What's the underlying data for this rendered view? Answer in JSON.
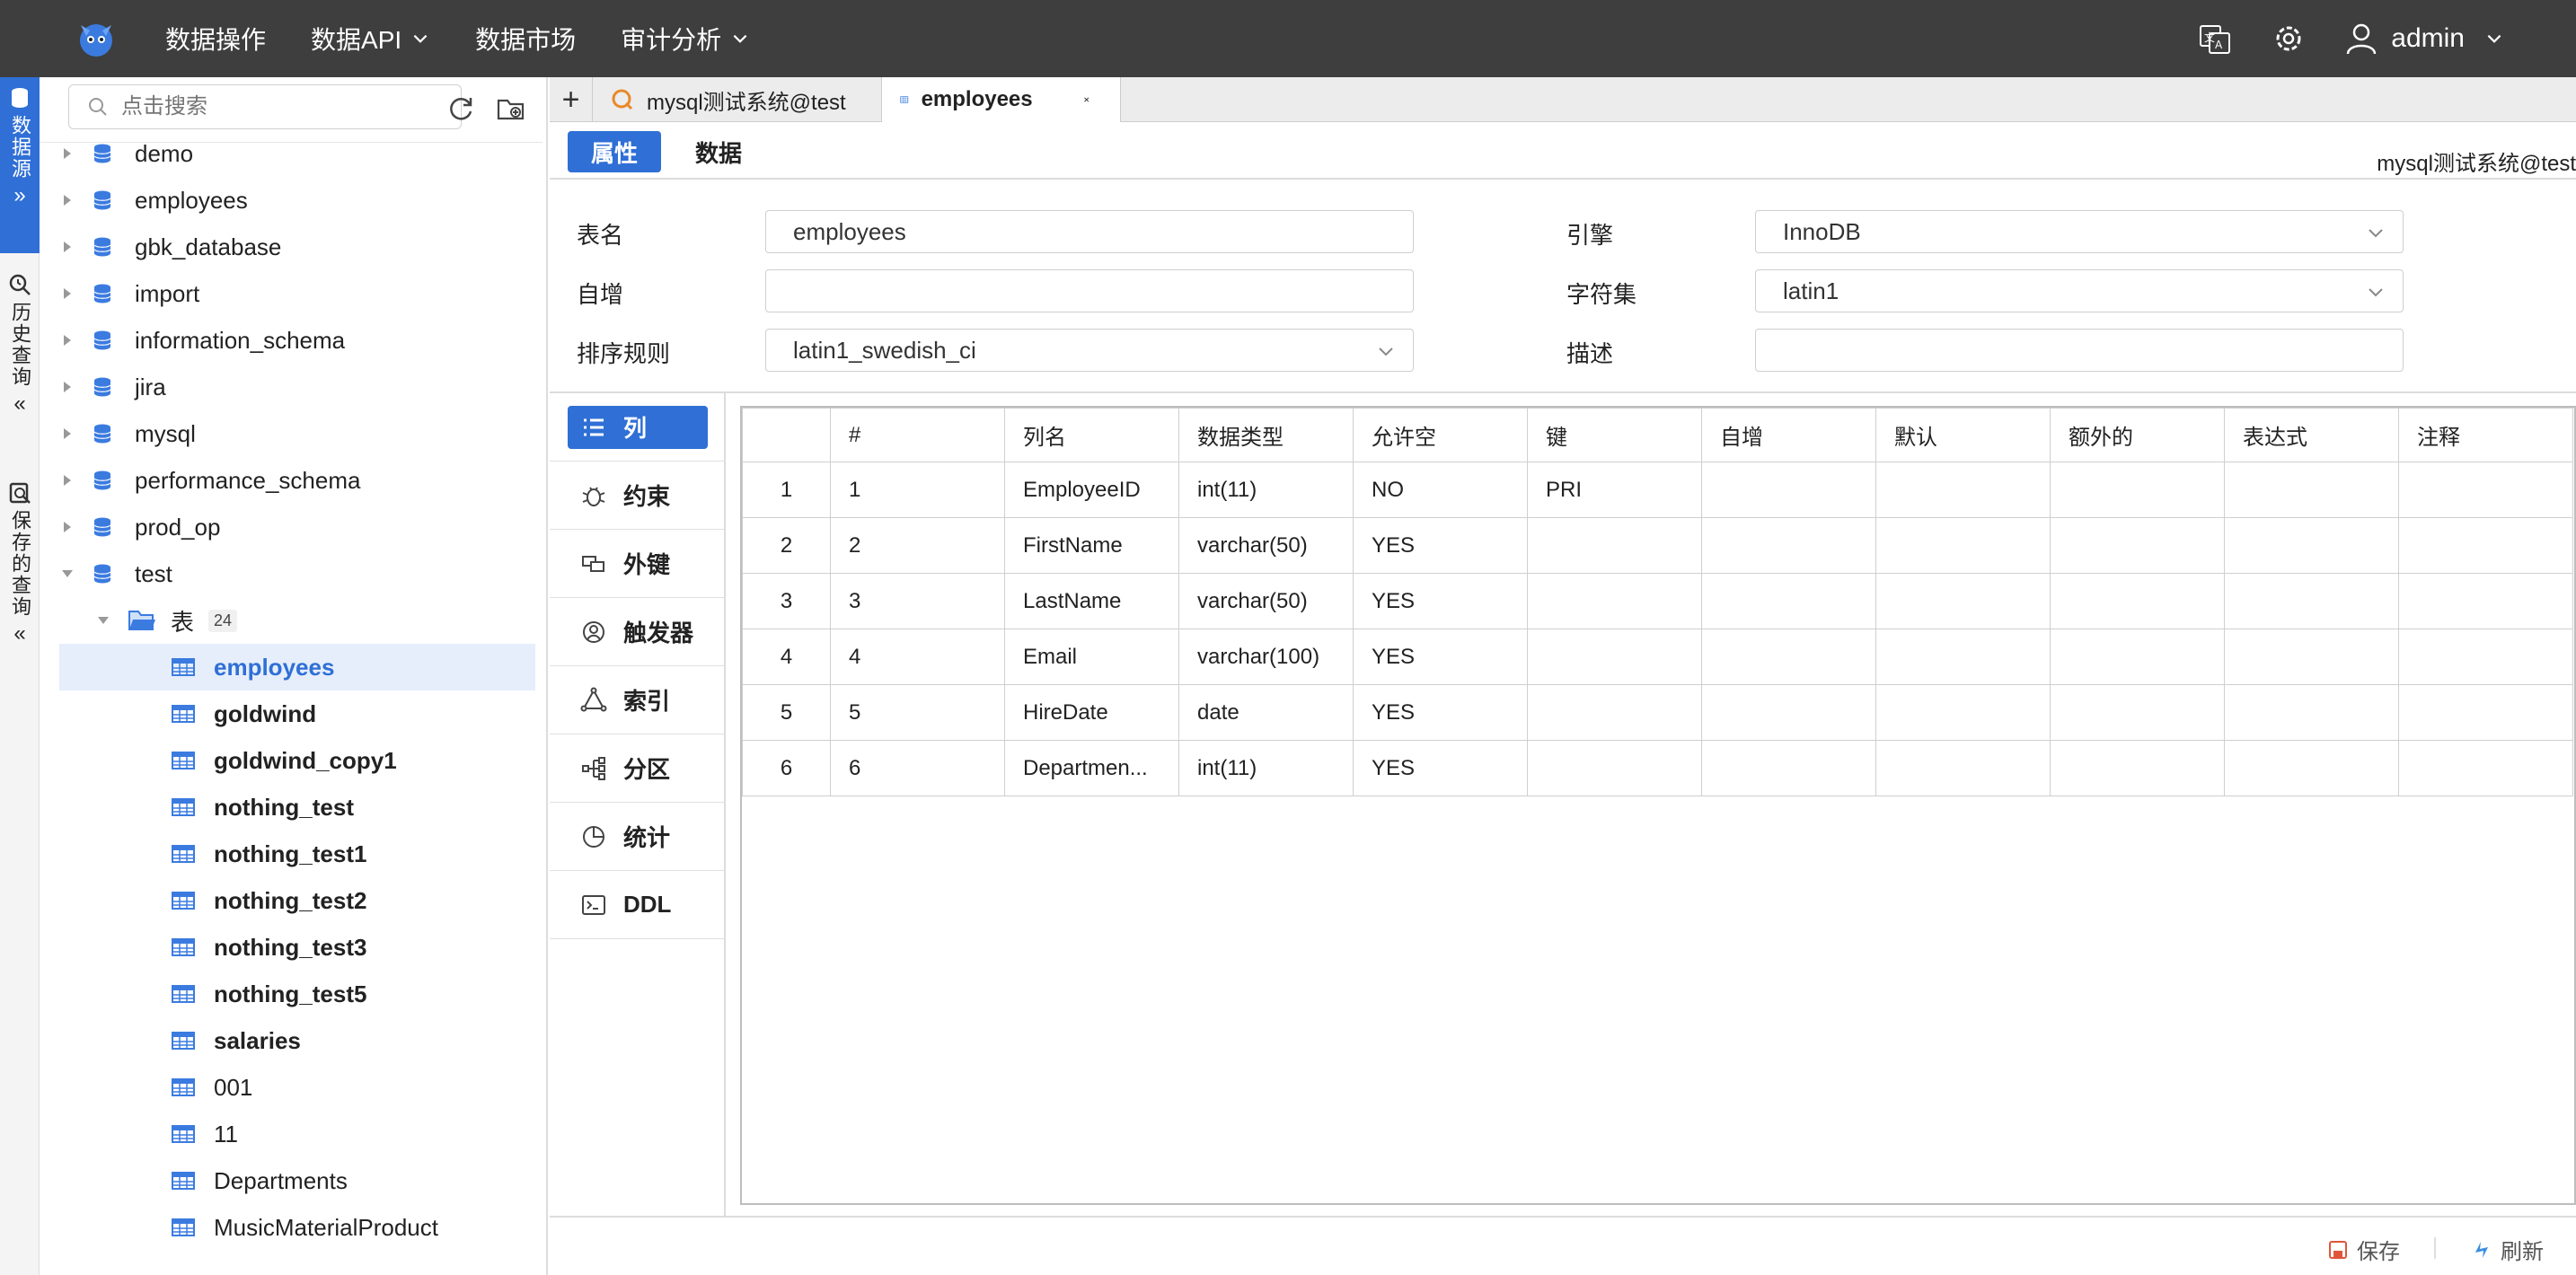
{
  "topnav": {
    "items": [
      {
        "label": "数据操作",
        "has_dropdown": false
      },
      {
        "label": "数据API",
        "has_dropdown": true
      },
      {
        "label": "数据市场",
        "has_dropdown": false
      },
      {
        "label": "审计分析",
        "has_dropdown": true
      }
    ],
    "user": "admin",
    "icons": [
      "translate-icon",
      "gear-icon",
      "user-icon"
    ]
  },
  "left_strip": {
    "tabs": [
      {
        "label": "数据源",
        "active": true
      },
      {
        "label": "历史查询",
        "active": false
      },
      {
        "label": "保存的查询",
        "active": false
      }
    ]
  },
  "tree": {
    "search_placeholder": "点击搜索",
    "databases": [
      "demo",
      "employees",
      "gbk_database",
      "import",
      "information_schema",
      "jira",
      "mysql",
      "performance_schema",
      "prod_op",
      "test"
    ],
    "folder": {
      "label": "表",
      "count": "24"
    },
    "tables": [
      "employees",
      "goldwind",
      "goldwind_copy1",
      "nothing_test",
      "nothing_test1",
      "nothing_test2",
      "nothing_test3",
      "nothing_test5",
      "salaries",
      "001",
      "11",
      "Departments",
      "MusicMaterialProduct"
    ],
    "selected": "employees"
  },
  "tabs": [
    {
      "label": "mysql测试系统@test",
      "active": false
    },
    {
      "label": "employees",
      "active": true
    }
  ],
  "subtabs": [
    "属性",
    "数据"
  ],
  "connection": "mysql测试系统@test",
  "properties": {
    "table_name_label": "表名",
    "table_name": "employees",
    "auto_inc_label": "自增",
    "auto_inc": "",
    "collation_label": "排序规则",
    "collation": "latin1_swedish_ci",
    "engine_label": "引擎",
    "engine": "InnoDB",
    "charset_label": "字符集",
    "charset": "latin1",
    "desc_label": "描述",
    "desc": ""
  },
  "side_menu": [
    "列",
    "约束",
    "外键",
    "触发器",
    "索引",
    "分区",
    "统计",
    "DDL"
  ],
  "columns_table": {
    "headers": [
      "",
      "#",
      "列名",
      "数据类型",
      "允许空",
      "键",
      "自增",
      "默认",
      "额外的",
      "表达式",
      "注释"
    ],
    "rows": [
      [
        "1",
        "1",
        "EmployeeID",
        "int(11)",
        "NO",
        "PRI",
        "",
        "",
        "",
        "",
        ""
      ],
      [
        "2",
        "2",
        "FirstName",
        "varchar(50)",
        "YES",
        "",
        "",
        "",
        "",
        "",
        ""
      ],
      [
        "3",
        "3",
        "LastName",
        "varchar(50)",
        "YES",
        "",
        "",
        "",
        "",
        "",
        ""
      ],
      [
        "4",
        "4",
        "Email",
        "varchar(100)",
        "YES",
        "",
        "",
        "",
        "",
        "",
        ""
      ],
      [
        "5",
        "5",
        "HireDate",
        "date",
        "YES",
        "",
        "",
        "",
        "",
        "",
        ""
      ],
      [
        "6",
        "6",
        "Departmen...",
        "int(11)",
        "YES",
        "",
        "",
        "",
        "",
        "",
        ""
      ]
    ]
  },
  "footer": {
    "save": "保存",
    "refresh": "刷新"
  },
  "colors": {
    "accent": "#2f6fd6",
    "topbar": "#3e3e3e"
  }
}
